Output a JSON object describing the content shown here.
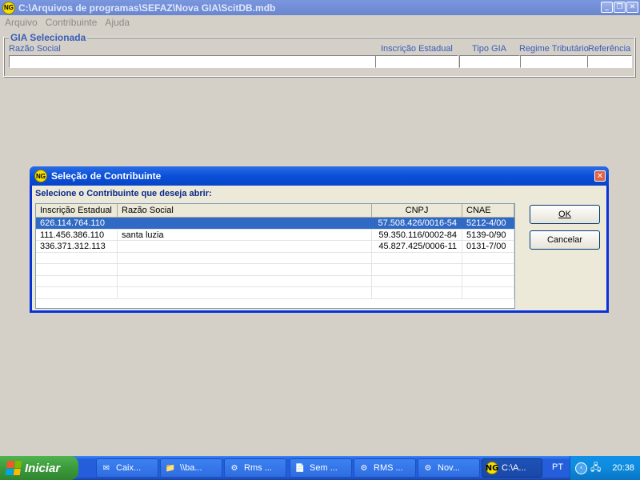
{
  "main_window": {
    "title": "C:\\Arquivos de programas\\SEFAZ\\Nova GIA\\ScitDB.mdb",
    "icon": "NG",
    "menu": [
      "Arquivo",
      "Contribuinte",
      "Ajuda"
    ]
  },
  "gia_panel": {
    "legend": "GIA Selecionada",
    "labels": {
      "razao_social": "Razão Social",
      "inscricao_estadual": "Inscrição Estadual",
      "tipo_gia": "Tipo GIA",
      "regime": "Regime Tributário",
      "referencia": "Referência"
    },
    "values": {
      "razao_social": "",
      "inscricao_estadual": "",
      "tipo_gia": "",
      "regime": "",
      "referencia": ""
    }
  },
  "dialog": {
    "title": "Seleção de Contribuinte",
    "icon": "NG",
    "prompt": "Selecione o Contribuinte que deseja abrir:",
    "columns": [
      "Inscrição Estadual",
      "Razão Social",
      "CNPJ",
      "CNAE"
    ],
    "rows": [
      {
        "ie": "626.114.764.110",
        "razao": "",
        "cnpj": "57.508.426/0016-54",
        "cnae": "5212-4/00",
        "selected": true
      },
      {
        "ie": "111.456.386.110",
        "razao": "santa luzia",
        "cnpj": "59.350.116/0002-84",
        "cnae": "5139-0/90",
        "selected": false
      },
      {
        "ie": "336.371.312.113",
        "razao": "",
        "cnpj": "45.827.425/0006-11",
        "cnae": "0131-7/00",
        "selected": false
      }
    ],
    "ok_label": "OK",
    "cancel_label": "Cancelar"
  },
  "taskbar": {
    "start_label": "Iniciar",
    "tasks": [
      {
        "label": "Caix...",
        "icon": "mail-icon",
        "active": false
      },
      {
        "label": "\\\\ba...",
        "icon": "folder-icon",
        "active": false
      },
      {
        "label": "Rms ...",
        "icon": "app-icon",
        "active": false
      },
      {
        "label": "Sem ...",
        "icon": "document-icon",
        "active": false
      },
      {
        "label": "RMS ...",
        "icon": "app-icon",
        "active": false
      },
      {
        "label": "Nov...",
        "icon": "app-icon",
        "active": false
      },
      {
        "label": "C:\\A...",
        "icon": "ng-icon",
        "active": true
      }
    ],
    "language": "PT",
    "clock": "20:38"
  }
}
